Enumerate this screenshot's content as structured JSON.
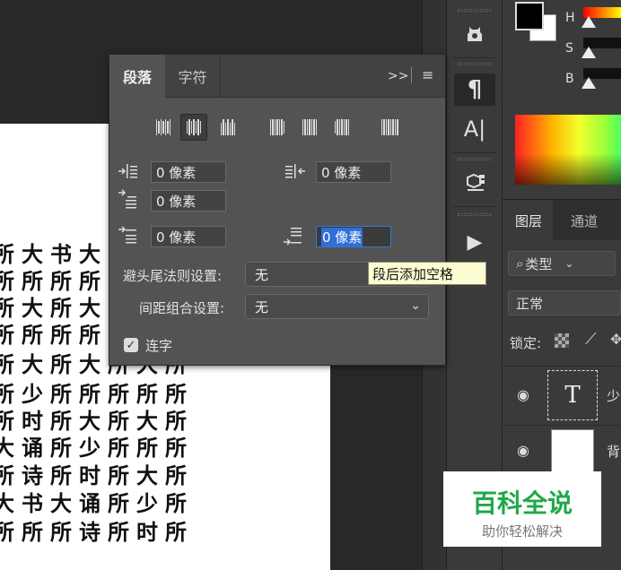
{
  "paragraph_panel": {
    "tabs": [
      "段落",
      "字符"
    ],
    "expand_glyph": ">>",
    "indent_left": {
      "value": "0 像素"
    },
    "indent_right": {
      "value": "0 像素"
    },
    "indent_first_line": {
      "value": "0 像素"
    },
    "space_before": {
      "value": "0 像素"
    },
    "space_after": {
      "value": "0 像素",
      "selected_text": "0 像素"
    },
    "kinsoku_label": "避头尾法则设置:",
    "kinsoku_value": "无",
    "mojikumi_label": "间距组合设置:",
    "mojikumi_value": "无",
    "hyphenate_label": "连字",
    "hyphenate_checked": true,
    "tooltip": "段后添加空格"
  },
  "color_panel": {
    "labels": [
      "H",
      "S",
      "B"
    ],
    "foreground": "#000000",
    "background": "#ffffff"
  },
  "layers_panel": {
    "tabs": [
      "图层",
      "通道"
    ],
    "filter_label": "类型",
    "blend_mode": "正常",
    "lock_label": "锁定:",
    "layers": [
      {
        "name": "少",
        "kind": "text",
        "thumb_glyph": "T"
      },
      {
        "name": "背",
        "kind": "background"
      }
    ]
  },
  "document": {
    "rows": [
      "所大书大",
      "所所所所",
      "所大所大",
      "所所所所",
      "所大所大所大所",
      "所少所所所所所",
      "所时所大所大所",
      "大诵所少所所所",
      "所诗所时所大所",
      "大书大诵所少所",
      "所所所诗所时所"
    ]
  },
  "watermark": {
    "title": "百科全说",
    "subtitle": "助你轻松解决"
  },
  "tools": [
    "ai-tool-icon",
    "paragraph-icon",
    "character-icon",
    "3d-icon",
    "play-icon"
  ],
  "tool_labels": {
    "paragraph": "¶",
    "character": "A|",
    "play": "▶"
  }
}
